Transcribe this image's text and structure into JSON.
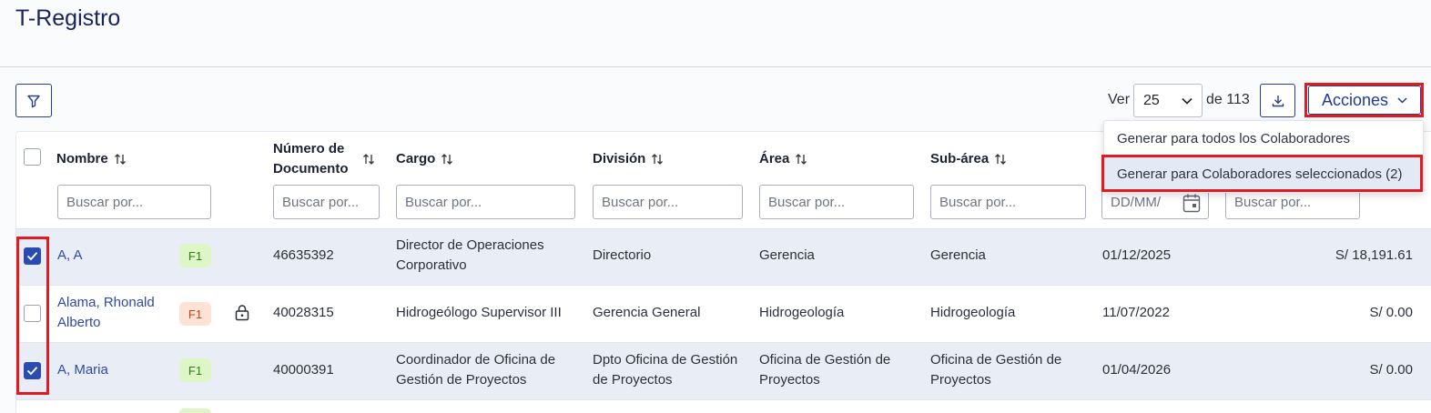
{
  "page": {
    "title": "T-Registro"
  },
  "toolbar": {
    "ver_label": "Ver",
    "page_size": "25",
    "total_label": "de 113",
    "acciones_label": "Acciones"
  },
  "acciones_menu": {
    "items": [
      {
        "label": "Generar para todos los Colaboradores"
      },
      {
        "label": "Generar para Colaboradores seleccionados (2)"
      }
    ]
  },
  "table": {
    "columns": {
      "nombre": "Nombre",
      "numero_documento": "Número de Documento",
      "cargo": "Cargo",
      "division": "División",
      "area": "Área",
      "subarea": "Sub-área"
    },
    "search_placeholder": "Buscar por...",
    "date_placeholder": "DD/MM/",
    "rows": [
      {
        "selected": true,
        "nombre": "A, A",
        "badge": "F1",
        "badge_color": "green",
        "locked": false,
        "documento": "46635392",
        "cargo": "Director de Operaciones Corporativo",
        "division": "Directorio",
        "area": "Gerencia",
        "subarea": "Gerencia",
        "fecha": "01/12/2025",
        "monto": "S/ 18,191.61"
      },
      {
        "selected": false,
        "nombre": "Alama, Rhonald Alberto",
        "badge": "F1",
        "badge_color": "orange",
        "locked": true,
        "documento": "40028315",
        "cargo": "Hidrogeólogo Supervisor III",
        "division": "Gerencia General",
        "area": "Hidrogeología",
        "subarea": "Hidrogeología",
        "fecha": "11/07/2022",
        "monto": "S/ 0.00"
      },
      {
        "selected": true,
        "nombre": "A, Maria",
        "badge": "F1",
        "badge_color": "green",
        "locked": false,
        "documento": "40000391",
        "cargo": "Coordinador de Oficina de Gestión de Proyectos",
        "division": "Dpto Oficina de Gestión de Proyectos",
        "area": "Oficina de Gestión de Proyectos",
        "subarea": "Oficina de Gestión de Proyectos",
        "fecha": "01/04/2026",
        "monto": "S/ 0.00"
      }
    ]
  },
  "colors": {
    "primary": "#2a3f8f",
    "link": "#2f49a8",
    "highlight": "#e01b22",
    "selected_row": "#e9edf6"
  }
}
